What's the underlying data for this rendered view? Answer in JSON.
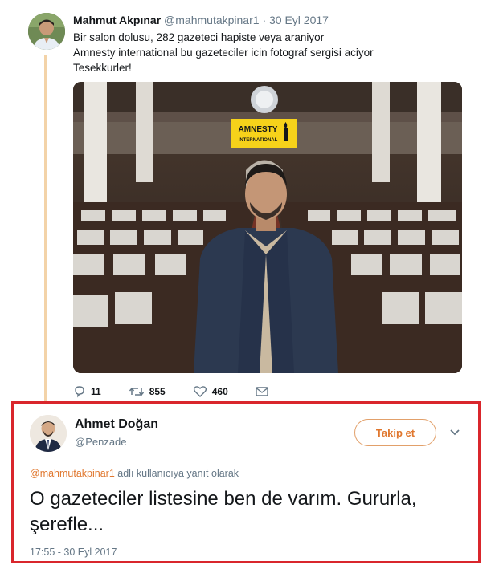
{
  "tweet": {
    "author_name": "Mahmut Akpınar",
    "author_handle": "@mahmutakpinar1",
    "separator": "·",
    "date": "30 Eyl 2017",
    "lines": [
      "Bir salon dolusu, 282 gazeteci hapiste veya araniyor",
      "Amnesty international bu gazeteciler icin fotograf sergisi aciyor",
      "Tesekkurler!"
    ],
    "photo": {
      "banner_line1": "AMNESTY",
      "banner_line2": "INTERNATIONAL"
    },
    "actions": {
      "reply_count": "11",
      "retweet_count": "855",
      "like_count": "460"
    }
  },
  "reply": {
    "author_name": "Ahmet Doğan",
    "author_handle": "@Penzade",
    "follow_label": "Takip et",
    "context_mention": "@mahmutakpinar1",
    "context_text": " adlı kullanıcıya yanıt olarak",
    "text": "O gazeteciler listesine ben de varım. Gururla, şerefle...",
    "timestamp": "17:55 - 30 Eyl 2017"
  },
  "colors": {
    "accent": "#e0772e",
    "highlight_border": "#d9262c",
    "thread_line": "#f3d3a8",
    "amnesty_yellow": "#f6d21a"
  },
  "icons": [
    "reply-icon",
    "retweet-icon",
    "heart-icon",
    "message-icon",
    "chevron-down-icon",
    "amnesty-candle-icon"
  ]
}
